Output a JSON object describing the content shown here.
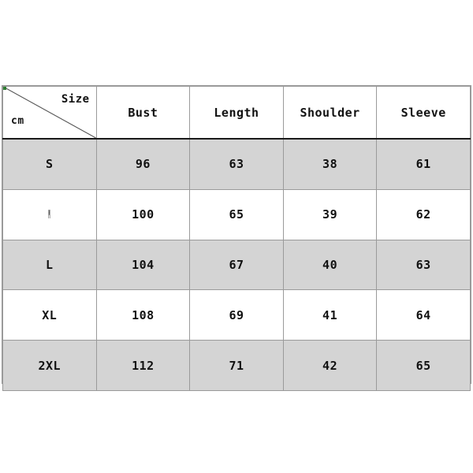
{
  "chart_data": {
    "type": "table",
    "title": "Size",
    "unit": "cm",
    "columns": [
      "Size",
      "Bust",
      "Length",
      "Shoulder",
      "Sleeve"
    ],
    "measure_columns": [
      "Bust",
      "Length",
      "Shoulder",
      "Sleeve"
    ],
    "categories": [
      "S",
      "M",
      "L",
      "XL",
      "2XL"
    ],
    "series": [
      {
        "name": "Bust",
        "values": [
          96,
          100,
          104,
          108,
          112
        ]
      },
      {
        "name": "Length",
        "values": [
          63,
          65,
          67,
          69,
          71
        ]
      },
      {
        "name": "Shoulder",
        "values": [
          38,
          39,
          40,
          41,
          42
        ]
      },
      {
        "name": "Sleeve",
        "values": [
          61,
          62,
          63,
          64,
          65
        ]
      }
    ],
    "rows": [
      {
        "size": "S",
        "bust": "96",
        "length": "63",
        "shoulder": "38",
        "sleeve": "61",
        "shaded": true
      },
      {
        "size": "M",
        "bust": "100",
        "length": "65",
        "shoulder": "39",
        "sleeve": "62",
        "shaded": false
      },
      {
        "size": "L",
        "bust": "104",
        "length": "67",
        "shoulder": "40",
        "sleeve": "63",
        "shaded": true
      },
      {
        "size": "XL",
        "bust": "108",
        "length": "69",
        "shoulder": "41",
        "sleeve": "64",
        "shaded": false
      },
      {
        "size": "2XL",
        "bust": "112",
        "length": "71",
        "shoulder": "42",
        "sleeve": "65",
        "shaded": true
      }
    ],
    "colors": {
      "shaded_row": "#d4d4d4",
      "plain_row": "#ffffff",
      "border": "#9a9a9a",
      "header_rule": "#1a1a1a",
      "text": "#111111",
      "corner_marker": "#2f7d32"
    },
    "grid": true,
    "legend": "none"
  },
  "header": {
    "corner": {
      "size_label": "Size",
      "unit_label": "cm"
    },
    "col_bust": "Bust",
    "col_length": "Length",
    "col_shoulder": "Shoulder",
    "col_sleeve": "Sleeve"
  },
  "rows": [
    {
      "size": "S",
      "bust": "96",
      "length": "63",
      "shoulder": "38",
      "sleeve": "61"
    },
    {
      "size": "M",
      "bust": "100",
      "length": "65",
      "shoulder": "39",
      "sleeve": "62"
    },
    {
      "size": "L",
      "bust": "104",
      "length": "67",
      "shoulder": "40",
      "sleeve": "63"
    },
    {
      "size": "XL",
      "bust": "108",
      "length": "69",
      "shoulder": "41",
      "sleeve": "64"
    },
    {
      "size": "2XL",
      "bust": "112",
      "length": "71",
      "shoulder": "42",
      "sleeve": "65"
    }
  ]
}
